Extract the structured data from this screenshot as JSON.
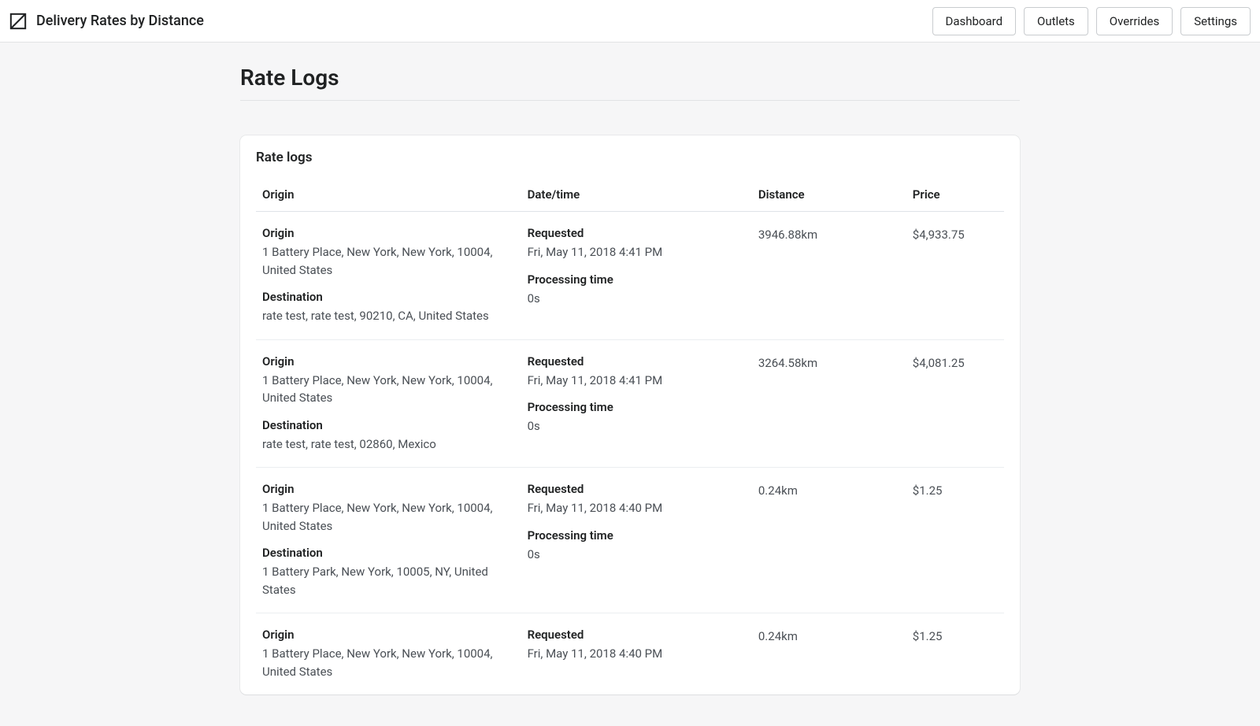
{
  "header": {
    "app_title": "Delivery Rates by Distance",
    "nav": {
      "dashboard": "Dashboard",
      "outlets": "Outlets",
      "overrides": "Overrides",
      "settings": "Settings"
    }
  },
  "page": {
    "title": "Rate Logs",
    "card_title": "Rate logs",
    "columns": {
      "origin": "Origin",
      "datetime": "Date/time",
      "distance": "Distance",
      "price": "Price"
    },
    "labels": {
      "origin": "Origin",
      "destination": "Destination",
      "requested": "Requested",
      "processing_time": "Processing time"
    },
    "rows": [
      {
        "origin": "1 Battery Place, New York, New York, 10004, United States",
        "destination": "rate test, rate test, 90210, CA, United States",
        "requested": "Fri, May 11, 2018 4:41 PM",
        "processing_time": "0s",
        "distance": "3946.88km",
        "price": "$4,933.75"
      },
      {
        "origin": "1 Battery Place, New York, New York, 10004, United States",
        "destination": "rate test, rate test, 02860, Mexico",
        "requested": "Fri, May 11, 2018 4:41 PM",
        "processing_time": "0s",
        "distance": "3264.58km",
        "price": "$4,081.25"
      },
      {
        "origin": "1 Battery Place, New York, New York, 10004, United States",
        "destination": "1 Battery Park, New York, 10005, NY, United States",
        "requested": "Fri, May 11, 2018 4:40 PM",
        "processing_time": "0s",
        "distance": "0.24km",
        "price": "$1.25"
      },
      {
        "origin": "1 Battery Place, New York, New York, 10004, United States",
        "destination": "",
        "requested": "Fri, May 11, 2018 4:40 PM",
        "processing_time": "",
        "distance": "0.24km",
        "price": "$1.25"
      }
    ]
  }
}
